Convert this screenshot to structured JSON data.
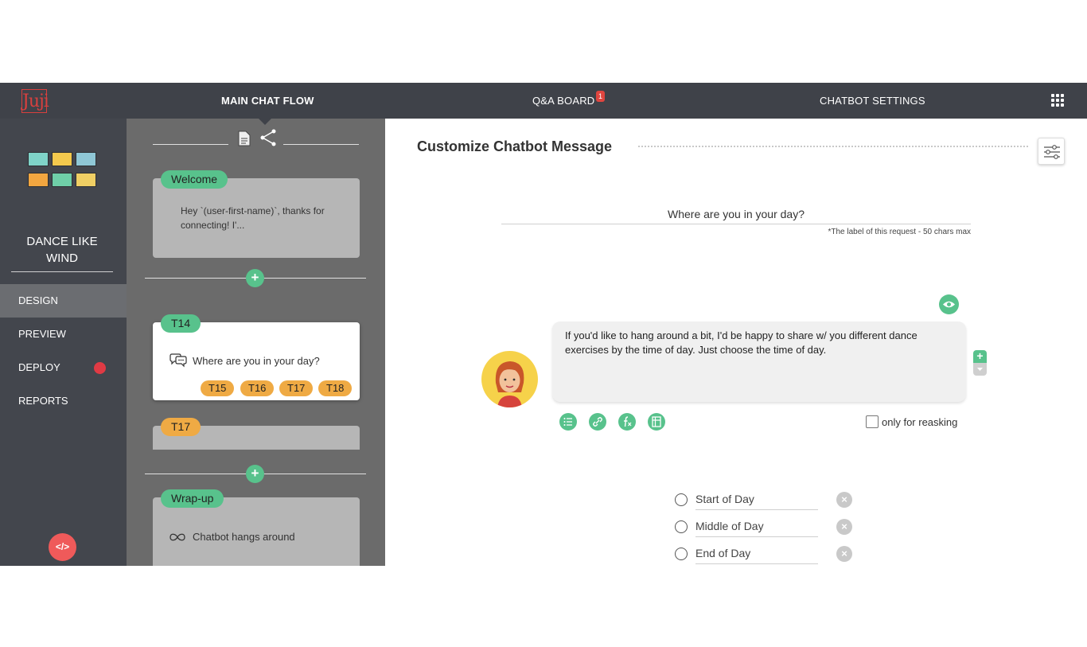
{
  "topbar": {
    "logo_text": "Juji",
    "nav": {
      "main_chat_flow": "MAIN CHAT FLOW",
      "qa_board": "Q&A BOARD",
      "qa_badge": "1",
      "chatbot_settings": "CHATBOT SETTINGS"
    }
  },
  "sidebar": {
    "bot_name": "DANCE LIKE WIND",
    "items": {
      "design": "DESIGN",
      "preview": "PREVIEW",
      "deploy": "DEPLOY",
      "reports": "REPORTS"
    },
    "embed_label": "</>"
  },
  "flow": {
    "welcome": {
      "tag": "Welcome",
      "text": "Hey `(user-first-name)`, thanks for connecting! I'..."
    },
    "t14": {
      "tag": "T14",
      "question": "Where are you in your day?",
      "branches": [
        "T15",
        "T16",
        "T17",
        "T18"
      ]
    },
    "t17": {
      "tag": "T17"
    },
    "wrapup": {
      "tag": "Wrap-up",
      "text": "Chatbot hangs around"
    },
    "add_label": "+"
  },
  "editor": {
    "title": "Customize Chatbot Message",
    "request_label": "Where are you in your day?",
    "label_hint": "*The label of this request - 50 chars max",
    "message": "If you'd like to hang around a bit, I'd be happy to share w/ you different dance exercises by the time of day. Just choose the time of day.",
    "reask_label": "only for reasking",
    "choices": [
      "Start of Day",
      "Middle of Day",
      "End of Day"
    ],
    "side_plus": "+",
    "delete_symbol": "×"
  },
  "colors": {
    "topbar": "#3f4249",
    "sidebar": "#43464d",
    "flow_bg": "#6b6b6b",
    "accent_green": "#58c28c",
    "accent_orange": "#efaa44",
    "alert_red": "#e03a44"
  }
}
